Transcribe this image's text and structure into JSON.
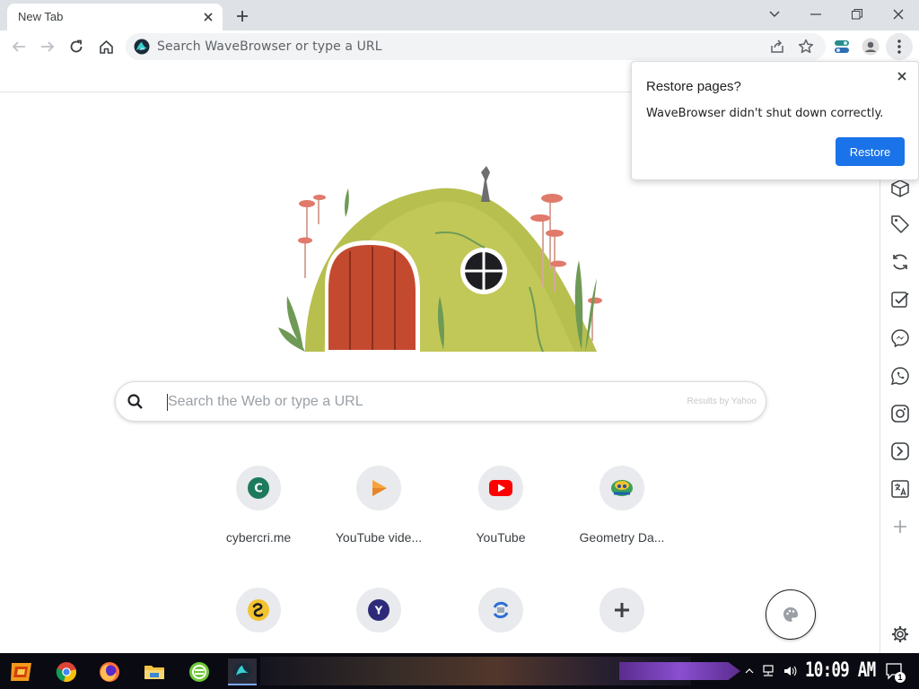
{
  "browser": {
    "tab_title": "New Tab",
    "omnibox_placeholder": "Search WaveBrowser or type a URL"
  },
  "search": {
    "placeholder": "Search the Web or type a URL",
    "provider": "Results by Yahoo"
  },
  "shortcuts": [
    {
      "label": "cybercri.me",
      "icon": "cybercrime-favicon"
    },
    {
      "label": "YouTube vide...",
      "icon": "youtube-video-favicon"
    },
    {
      "label": "YouTube",
      "icon": "youtube-favicon"
    },
    {
      "label": "Geometry Da...",
      "icon": "geometry-dash-favicon"
    },
    {
      "label": "",
      "icon": "yellow-snake-favicon"
    },
    {
      "label": "",
      "icon": "y-favicon"
    },
    {
      "label": "",
      "icon": "refresh-favicon"
    },
    {
      "label": "",
      "icon": "add-shortcut-icon"
    }
  ],
  "sidebar_icons": [
    "box-icon",
    "tag-icon",
    "sync-icon",
    "checklist-icon",
    "messenger-icon",
    "whatsapp-icon",
    "instagram-icon",
    "wave-icon",
    "translate-icon",
    "add-icon",
    "settings-icon"
  ],
  "popup": {
    "title": "Restore pages?",
    "message": "WaveBrowser didn't shut down correctly.",
    "button": "Restore"
  },
  "taskbar": {
    "clock": "10:09 AM",
    "notification_count": "1"
  },
  "colors": {
    "accent": "#1a73e8",
    "tabstrip": "#dee1e6",
    "omnibox": "#f1f3f4"
  }
}
